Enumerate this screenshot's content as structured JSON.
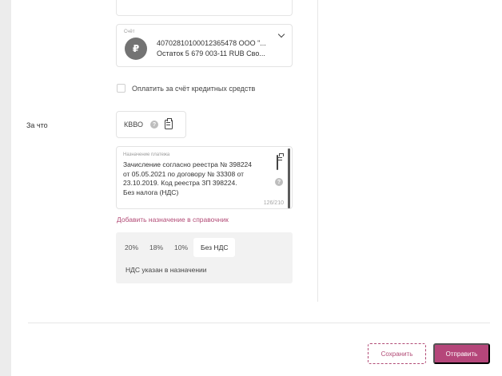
{
  "account": {
    "label": "Счёт",
    "currency_symbol": "₽",
    "number": "40702810100012365478 ООО \"...",
    "balance": "Остаток 5 679 003-11 RUB Сво..."
  },
  "credit": {
    "label": "Оплатить за счёт кредитных средств",
    "checked": false
  },
  "purpose_section": {
    "label": "За что"
  },
  "kbvo": {
    "label": "КВВО",
    "help_symbol": "?"
  },
  "payment_purpose": {
    "label": "Назначение платежа",
    "lines": [
      "Зачисление согласно реестра № 398224",
      "от 05.05.2021 по договору № 33308 от",
      "23.10.2019. Код реестра ЗП 398224.",
      "Без налога (НДС)"
    ],
    "counter": "126/210",
    "help_symbol": "?"
  },
  "add_to_directory": "Добавить назначение в справочник",
  "vat": {
    "options": [
      "20%",
      "18%",
      "10%",
      "Без НДС"
    ],
    "selected": "Без НДС",
    "note": "НДС указан в назначении"
  },
  "actions": {
    "save_label": "Сохранить",
    "send_label": "Отправить"
  },
  "colors": {
    "accent": "#b5467a",
    "avatar": "#737373",
    "panel": "#f2f2f2"
  }
}
